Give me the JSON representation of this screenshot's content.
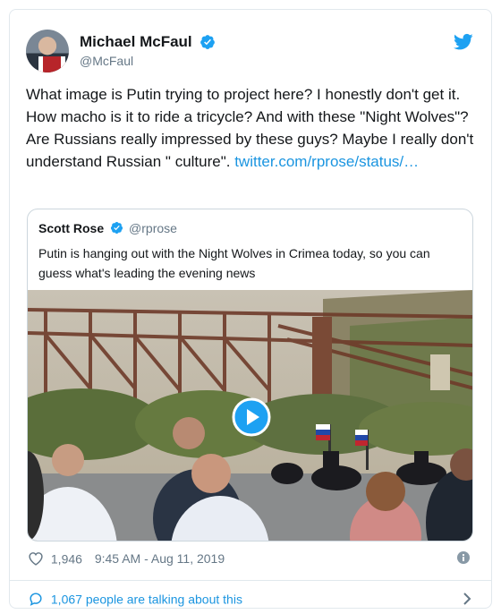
{
  "author": {
    "display_name": "Michael McFaul",
    "handle": "@McFaul"
  },
  "tweet": {
    "text": "What image is Putin trying to project here? I honestly don't get it. How macho is it to ride a tricycle? And with these \"Night Wolves\"? Are Russians really impressed by these guys? Maybe I really don't understand Russian \" culture\". ",
    "link_text": "twitter.com/rprose/status/…"
  },
  "quoted_tweet": {
    "display_name": "Scott Rose",
    "handle": "@rprose",
    "text": "Putin is hanging out with the Night Wolves in Crimea today, so you can guess what's leading the evening news"
  },
  "footer": {
    "likes": "1,946",
    "timestamp": "9:45 AM - Aug 11, 2019",
    "talking": "1,067 people are talking about this"
  },
  "icons": {
    "verified": "verified-badge-icon",
    "brand": "twitter-bird-icon",
    "like": "heart-icon",
    "info": "info-icon",
    "reply": "speech-bubble-icon",
    "more": "chevron-right-icon",
    "media": "play-button-icon"
  },
  "colors": {
    "accent": "#1da1f2",
    "link": "#1b95e0",
    "muted": "#657786",
    "border": "#e1e8ed"
  }
}
